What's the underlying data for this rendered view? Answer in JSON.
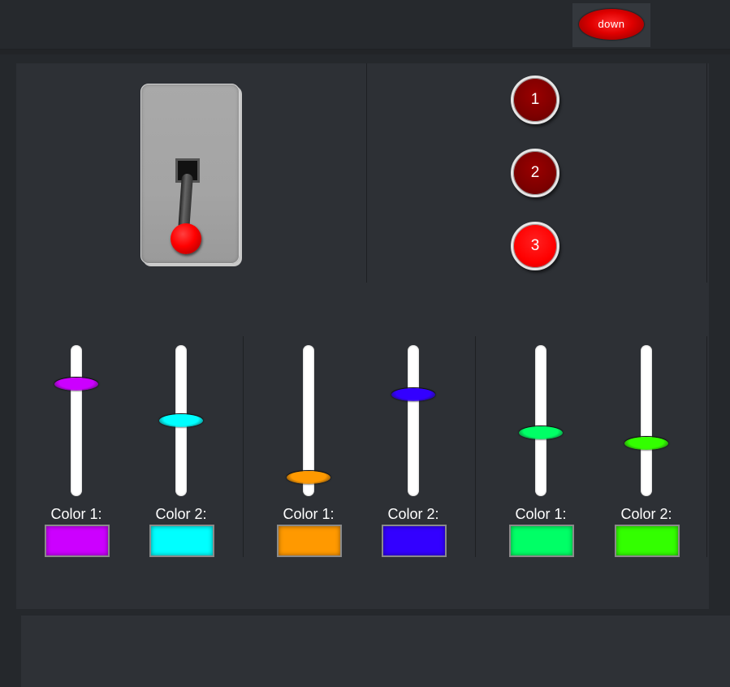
{
  "status": {
    "label": "down",
    "color": "#e00000"
  },
  "toggle_switch": {
    "position": "down",
    "knob_color": "#ff0000"
  },
  "round_buttons": [
    {
      "label": "1",
      "state": "off"
    },
    {
      "label": "2",
      "state": "off"
    },
    {
      "label": "3",
      "state": "on"
    }
  ],
  "slider_groups": [
    {
      "sliders": [
        {
          "label": "Color 1:",
          "color": "#cc00ff",
          "level": 0.78
        },
        {
          "label": "Color 2:",
          "color": "#00ffff",
          "level": 0.5
        }
      ]
    },
    {
      "sliders": [
        {
          "label": "Color 1:",
          "color": "#ff9900",
          "level": 0.07
        },
        {
          "label": "Color 2:",
          "color": "#3300ff",
          "level": 0.7
        }
      ]
    },
    {
      "sliders": [
        {
          "label": "Color 1:",
          "color": "#00ff66",
          "level": 0.41
        },
        {
          "label": "Color 2:",
          "color": "#33ff00",
          "level": 0.33
        }
      ]
    }
  ]
}
